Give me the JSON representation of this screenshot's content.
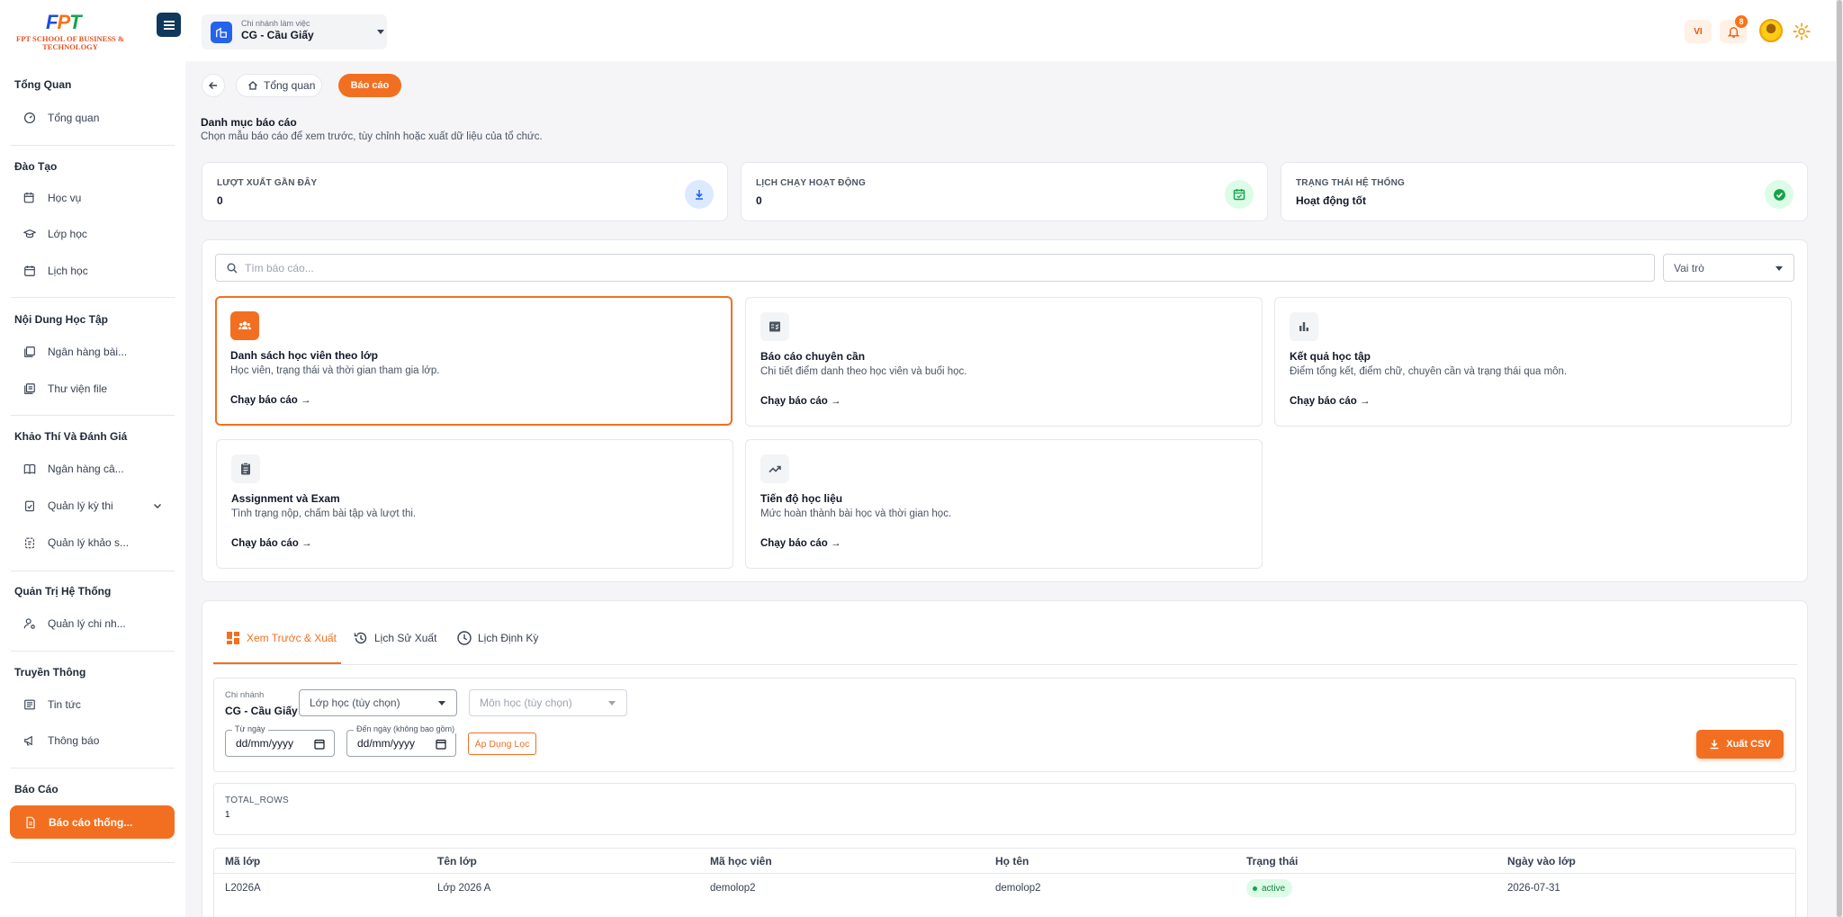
{
  "brand": {
    "logo_text": "FPT",
    "logo_sub": "FPT SCHOOL OF BUSINESS & TECHNOLOGY"
  },
  "sidebar": {
    "sections": [
      {
        "title": "Tổng Quan",
        "items": [
          "Tổng quan"
        ]
      },
      {
        "title": "Đào Tạo",
        "items": [
          "Học vụ",
          "Lớp học",
          "Lịch học"
        ]
      },
      {
        "title": "Nội Dung Học Tập",
        "items": [
          "Ngân hàng bài...",
          "Thư viện file"
        ]
      },
      {
        "title": "Khảo Thí Và Đánh Giá",
        "items": [
          "Ngân hàng câ...",
          "Quản lý kỳ thi",
          "Quản lý khảo s..."
        ]
      },
      {
        "title": "Quản Trị Hệ Thống",
        "items": [
          "Quản lý chi nh..."
        ]
      },
      {
        "title": "Truyền Thông",
        "items": [
          "Tin tức",
          "Thông báo"
        ]
      },
      {
        "title": "Báo Cáo",
        "items": [
          "Báo cáo thống..."
        ]
      }
    ]
  },
  "header": {
    "branch_label": "Chi nhánh làm việc",
    "branch_value": "CG - Cầu Giấy",
    "lang": "VI",
    "notifications": "8"
  },
  "breadcrumb": {
    "home": "Tổng quan",
    "current": "Báo cáo"
  },
  "page": {
    "title": "Danh mục báo cáo",
    "subtitle": "Chọn mẫu báo cáo để xem trước, tùy chỉnh hoặc xuất dữ liệu của tổ chức."
  },
  "stats": [
    {
      "label": "LƯỢT XUẤT GẦN ĐÂY",
      "value": "0",
      "icon": "download-icon",
      "color": "#2563eb"
    },
    {
      "label": "LỊCH CHẠY HOẠT ĐỘNG",
      "value": "0",
      "icon": "calendar-check-icon",
      "color": "#16a34a"
    },
    {
      "label": "TRẠNG THÁI HỆ THỐNG",
      "value": "Hoạt động tốt",
      "icon": "check-circle-icon",
      "color": "#16a34a"
    }
  ],
  "catalog": {
    "search_placeholder": "Tìm báo cáo...",
    "role_select": "Vai trò",
    "run_label": "Chạy báo cáo →",
    "reports": [
      {
        "title": "Danh sách học viên theo lớp",
        "desc": "Học viên, trạng thái và thời gian tham gia lớp.",
        "icon": "users-icon"
      },
      {
        "title": "Báo cáo chuyên cần",
        "desc": "Chi tiết điểm danh theo học viên và buổi học.",
        "icon": "checklist-icon"
      },
      {
        "title": "Kết quả học tập",
        "desc": "Điểm tổng kết, điểm chữ, chuyên cần và trạng thái qua môn.",
        "icon": "bar-chart-icon"
      },
      {
        "title": "Assignment và Exam",
        "desc": "Tình trạng nộp, chấm bài tập và lượt thi.",
        "icon": "clipboard-icon"
      },
      {
        "title": "Tiến độ học liệu",
        "desc": "Mức hoàn thành bài học và thời gian học.",
        "icon": "trending-up-icon"
      }
    ]
  },
  "preview": {
    "tabs": [
      "Xem Trước & Xuất",
      "Lịch Sử Xuất",
      "Lịch Định Kỳ"
    ],
    "filters": {
      "branch_label": "Chi nhánh",
      "branch_value": "CG - Cầu Giấy",
      "class_placeholder": "Lớp học (tùy chọn)",
      "subject_placeholder": "Môn học (tùy chọn)",
      "from_label": "Từ ngày",
      "from_value": "dd/mm/yyyy",
      "to_label": "Đến ngày (không bao gồm)",
      "to_value": "dd/mm/yyyy",
      "apply": "Áp Dụng Lọc",
      "export": "Xuất CSV"
    },
    "total_label": "TOTAL_ROWS",
    "total_value": "1",
    "table": {
      "headers": [
        "Mã lớp",
        "Tên lớp",
        "Mã học viên",
        "Họ tên",
        "Trạng thái",
        "Ngày vào lớp"
      ],
      "rows": [
        [
          "L2026A",
          "Lớp 2026 A",
          "demolop2",
          "demolop2",
          "active",
          "2026-07-31"
        ]
      ]
    }
  },
  "colors": {
    "accent": "#f26f21",
    "navy": "#10375c"
  }
}
